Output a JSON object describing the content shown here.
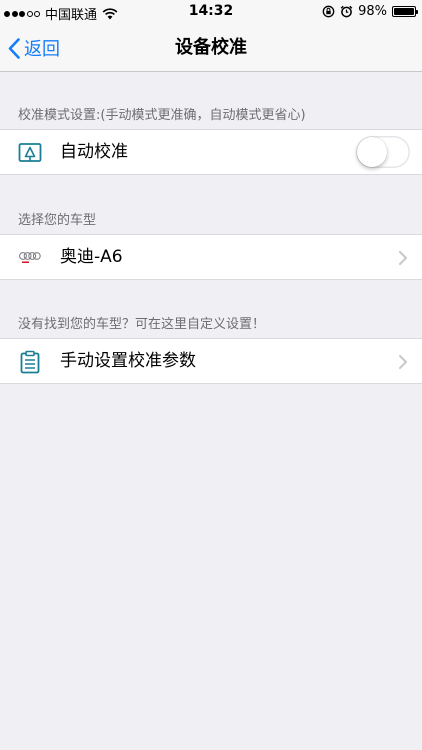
{
  "status_bar": {
    "carrier": "中国联通",
    "time": "14:32",
    "battery": "98%",
    "battery_level": 0.98,
    "signal_bars_filled": 3,
    "signal_bars_total": 5
  },
  "nav": {
    "back_label": "返回",
    "title": "设备校准"
  },
  "calibration_section": {
    "header": "校准模式设置:(手动模式更准确，自动模式更省心)",
    "auto_label": "自动校准",
    "auto_enabled": false
  },
  "car_section": {
    "header": "选择您的车型",
    "car_label": "奥迪-A6",
    "car_icon": "audi-rings-icon"
  },
  "manual_section": {
    "header": "没有找到您的车型？可在这里自定义设置！",
    "manual_label": "手动设置校准参数",
    "manual_icon": "clipboard-icon"
  },
  "colors": {
    "accent": "#157efb",
    "icon_teal": "#1a7f95",
    "background": "#efeff4"
  }
}
